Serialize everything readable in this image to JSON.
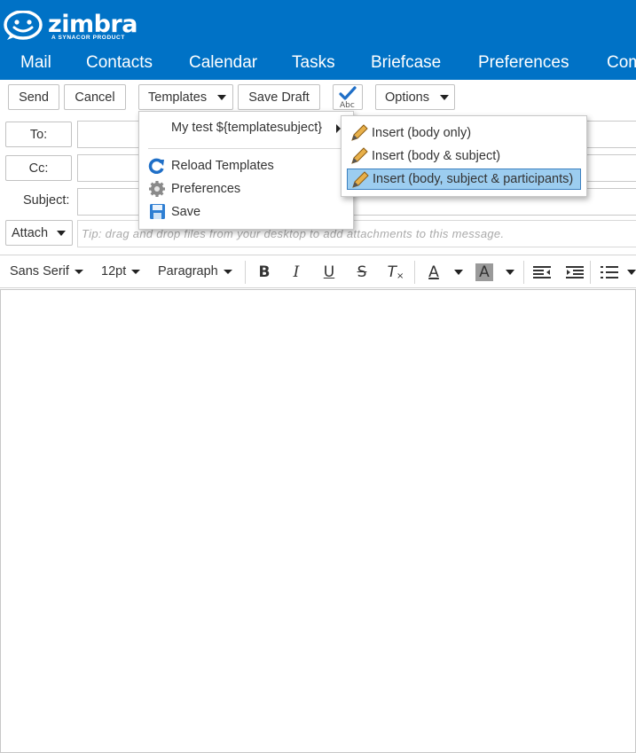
{
  "app": {
    "logo_text": "zimbra",
    "logo_subtitle": "A SYNACOR PRODUCT",
    "brand_color": "#0072c6"
  },
  "nav": {
    "items": [
      "Mail",
      "Contacts",
      "Calendar",
      "Tasks",
      "Briefcase",
      "Preferences",
      "Com"
    ]
  },
  "toolbar": {
    "send_label": "Send",
    "cancel_label": "Cancel",
    "templates_label": "Templates",
    "save_draft_label": "Save Draft",
    "options_label": "Options",
    "spellcheck_icon": "spellcheck-icon",
    "spellcheck_text": "Abc"
  },
  "compose": {
    "to_label": "To:",
    "cc_label": "Cc:",
    "subject_label": "Subject:",
    "to_value": "",
    "cc_value": "",
    "subject_value": "",
    "attach_label": "Attach",
    "attach_tip": "Tip: drag and drop files from your desktop to add attachments to this message."
  },
  "editor_toolbar": {
    "font_family": "Sans Serif",
    "font_size": "12pt",
    "block_format": "Paragraph",
    "bold_glyph": "B",
    "italic_glyph": "I",
    "underline_glyph": "U",
    "strike_glyph": "S",
    "clear_glyph": "T",
    "text_color_glyph": "A",
    "highlight_glyph": "A"
  },
  "templates_menu": {
    "items": [
      {
        "label": "My test ${templatesubject}",
        "icon": "submenu-arrow-icon"
      },
      {
        "label": "Reload Templates",
        "icon": "refresh-icon"
      },
      {
        "label": "Preferences",
        "icon": "gear-icon"
      },
      {
        "label": "Save",
        "icon": "save-icon"
      }
    ]
  },
  "template_submenu": {
    "items": [
      {
        "label": "Insert (body only)",
        "selected": false
      },
      {
        "label": "Insert (body & subject)",
        "selected": false
      },
      {
        "label": "Insert (body, subject & participants)",
        "selected": true
      }
    ]
  }
}
